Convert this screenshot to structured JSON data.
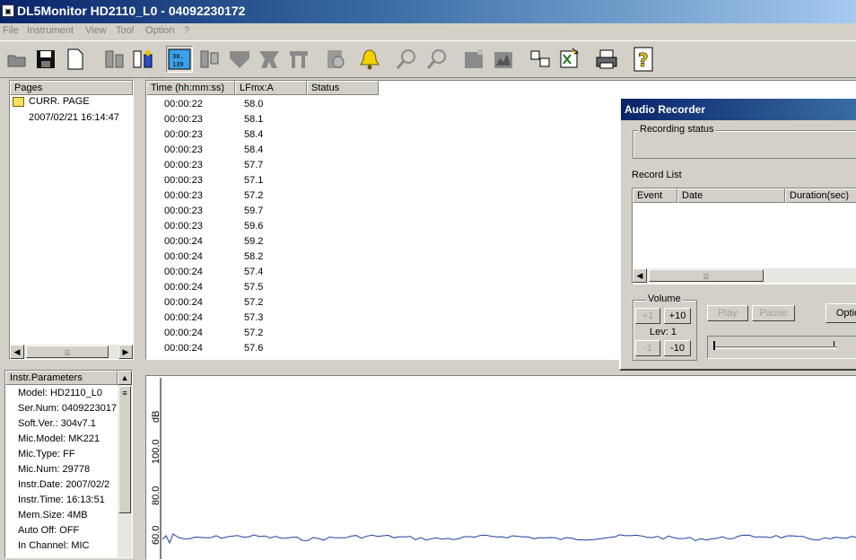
{
  "app": {
    "title": "DL5Monitor HD2110_L0 - 04092230172",
    "icon": "app-icon"
  },
  "menu": [
    "File",
    "Instrument",
    "View",
    "Tool",
    "Option",
    "?"
  ],
  "pages_panel": {
    "header": "Pages",
    "root": "CURR. PAGE",
    "child": "2007/02/21 16:14:47"
  },
  "data_table": {
    "columns": [
      "Time (hh:mm:ss)",
      "LFmx:A",
      "Status"
    ],
    "rows": [
      {
        "time": "00:00:22",
        "value": "58.0"
      },
      {
        "time": "00:00:23",
        "value": "58.1"
      },
      {
        "time": "00:00:23",
        "value": "58.4"
      },
      {
        "time": "00:00:23",
        "value": "58.4"
      },
      {
        "time": "00:00:23",
        "value": "57.7"
      },
      {
        "time": "00:00:23",
        "value": "57.1"
      },
      {
        "time": "00:00:23",
        "value": "57.2"
      },
      {
        "time": "00:00:23",
        "value": "59.7"
      },
      {
        "time": "00:00:23",
        "value": "59.6"
      },
      {
        "time": "00:00:24",
        "value": "59.2"
      },
      {
        "time": "00:00:24",
        "value": "58.2"
      },
      {
        "time": "00:00:24",
        "value": "57.4"
      },
      {
        "time": "00:00:24",
        "value": "57.5"
      },
      {
        "time": "00:00:24",
        "value": "57.2"
      },
      {
        "time": "00:00:24",
        "value": "57.3"
      },
      {
        "time": "00:00:24",
        "value": "57.2"
      },
      {
        "time": "00:00:24",
        "value": "57.6"
      }
    ]
  },
  "instr_params": {
    "header": "Instr.Parameters",
    "items": [
      "Model: HD2110_L0",
      "Ser.Num: 0409223017",
      "Soft.Ver.: 304v7.1",
      "Mic.Model: MK221",
      "Mic.Type: FF",
      "Mic.Num: 29778",
      "Instr.Date: 2007/02/2",
      "Instr.Time: 16:13:51",
      "Mem.Size: 4MB",
      "Auto Off: OFF",
      "In Channel: MIC"
    ]
  },
  "graph": {
    "unit": "dB",
    "ticks": [
      "100.0",
      "80.0",
      "60.0"
    ],
    "line_color": "#1f3fa0"
  },
  "audio_recorder": {
    "title": "Audio Recorder",
    "recording_status_label": "Recording status",
    "record_list_label": "Record List",
    "columns": [
      "Event",
      "Date",
      "Duration(sec)"
    ],
    "volume_label": "Volume",
    "plus1": "+1",
    "plus10": "+10",
    "minus1": "-1",
    "minus10": "-10",
    "level": "Lev: 1",
    "play": "Play",
    "pause": "Pause",
    "options": "Optio"
  }
}
